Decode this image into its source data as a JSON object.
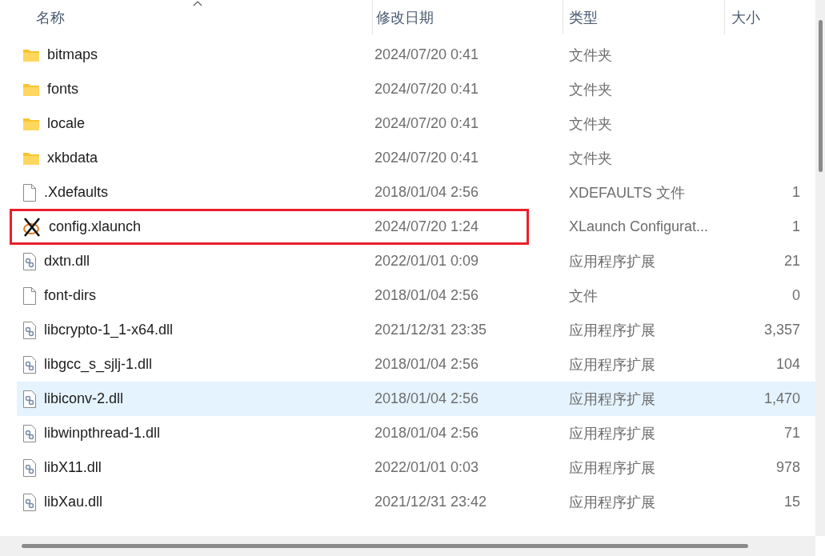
{
  "columns": [
    {
      "label": "名称",
      "sorted": true
    },
    {
      "label": "修改日期",
      "sorted": false
    },
    {
      "label": "类型",
      "sorted": false
    },
    {
      "label": "大小",
      "sorted": false
    }
  ],
  "rows": [
    {
      "kind": "folder",
      "name": "bitmaps",
      "date": "2024/07/20 0:41",
      "type": "文件夹",
      "selected": false,
      "outlined": false
    },
    {
      "kind": "folder",
      "name": "fonts",
      "date": "2024/07/20 0:41",
      "type": "文件夹",
      "selected": false,
      "outlined": false
    },
    {
      "kind": "folder",
      "name": "locale",
      "date": "2024/07/20 0:41",
      "type": "文件夹",
      "selected": false,
      "outlined": false
    },
    {
      "kind": "folder",
      "name": "xkbdata",
      "date": "2024/07/20 0:41",
      "type": "文件夹",
      "selected": false,
      "outlined": false
    },
    {
      "kind": "file",
      "name": ".Xdefaults",
      "date": "2018/01/04 2:56",
      "type": "XDEFAULTS 文件",
      "size": "1",
      "selected": false,
      "outlined": false
    },
    {
      "kind": "xlaunch",
      "name": "config.xlaunch",
      "date": "2024/07/20 1:24",
      "type": "XLaunch Configurat...",
      "size": "1",
      "selected": false,
      "outlined": true
    },
    {
      "kind": "dll",
      "name": "dxtn.dll",
      "date": "2022/01/01 0:09",
      "type": "应用程序扩展",
      "size": "21",
      "selected": false,
      "outlined": false
    },
    {
      "kind": "file",
      "name": "font-dirs",
      "date": "2018/01/04 2:56",
      "type": "文件",
      "size": "0",
      "selected": false,
      "outlined": false
    },
    {
      "kind": "dll",
      "name": "libcrypto-1_1-x64.dll",
      "date": "2021/12/31 23:35",
      "type": "应用程序扩展",
      "size": "3,357",
      "selected": false,
      "outlined": false
    },
    {
      "kind": "dll",
      "name": "libgcc_s_sjlj-1.dll",
      "date": "2018/01/04 2:56",
      "type": "应用程序扩展",
      "size": "104",
      "selected": false,
      "outlined": false
    },
    {
      "kind": "dll",
      "name": "libiconv-2.dll",
      "date": "2018/01/04 2:56",
      "type": "应用程序扩展",
      "size": "1,470",
      "selected": true,
      "outlined": false
    },
    {
      "kind": "dll",
      "name": "libwinpthread-1.dll",
      "date": "2018/01/04 2:56",
      "type": "应用程序扩展",
      "size": "71",
      "selected": false,
      "outlined": false
    },
    {
      "kind": "dll",
      "name": "libX11.dll",
      "date": "2022/01/01 0:03",
      "type": "应用程序扩展",
      "size": "978",
      "selected": false,
      "outlined": false
    },
    {
      "kind": "dll",
      "name": "libXau.dll",
      "date": "2021/12/31 23:42",
      "type": "应用程序扩展",
      "size": "15",
      "selected": false,
      "outlined": false
    }
  ]
}
